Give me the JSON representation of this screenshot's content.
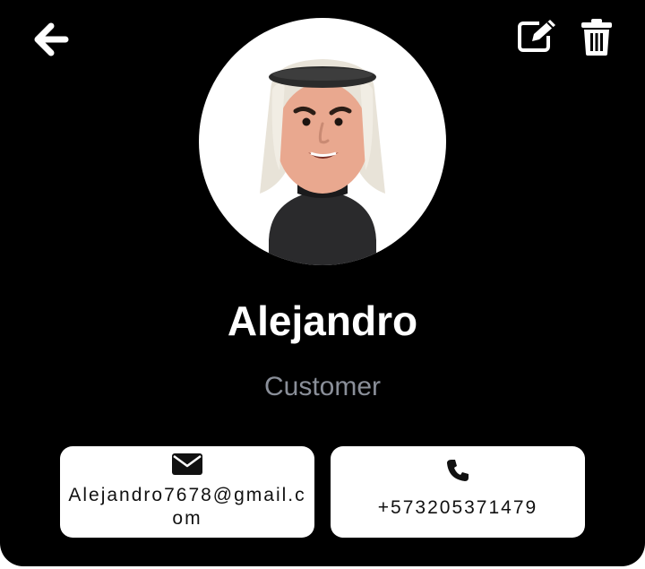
{
  "profile": {
    "name": "Alejandro",
    "role": "Customer",
    "avatar_icon": "person-avatar"
  },
  "header": {
    "back_icon": "arrow-left-icon",
    "edit_icon": "edit-icon",
    "delete_icon": "trash-icon"
  },
  "contact": {
    "email": "Alejandro7678@gmail.com",
    "email_icon": "envelope-icon",
    "phone": "+573205371479",
    "phone_icon": "phone-icon"
  },
  "colors": {
    "background": "#000000",
    "card": "#ffffff",
    "name_text": "#ffffff",
    "role_text": "#8a8f99"
  }
}
